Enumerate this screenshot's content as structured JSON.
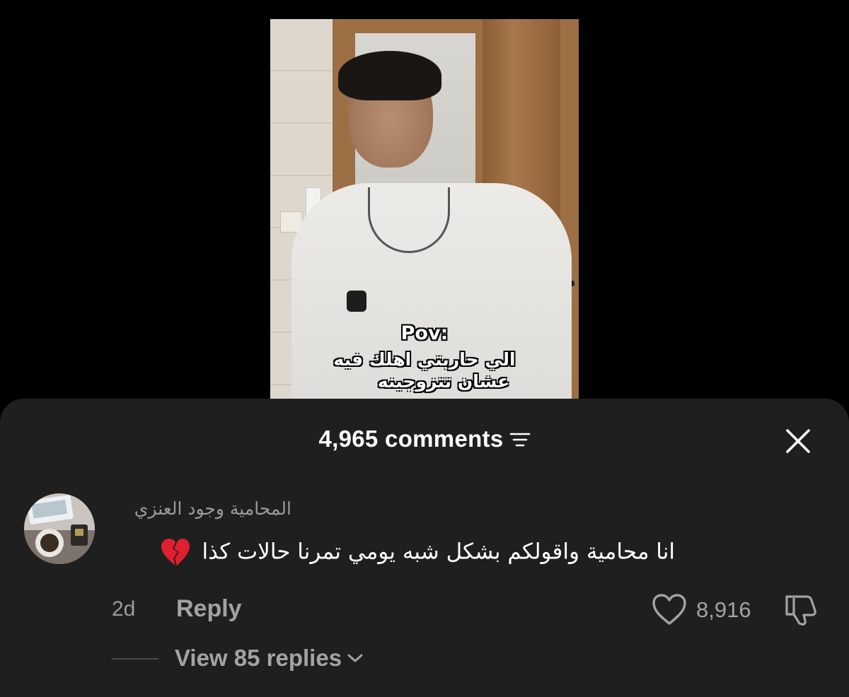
{
  "video": {
    "caption_line1": "Pov:",
    "caption_line2": "الي حاربتي اهلك فيه",
    "caption_line3": "عشان تتزوجينه"
  },
  "sheet": {
    "comments_count": "4,965 comments",
    "close_label": "×"
  },
  "comment": {
    "author": "المحامية وجود العنزي",
    "text": "انا محامية واقولكم بشكل شبه يومي تمرنا حالات كذا",
    "emoji": "broken-heart-emoji",
    "age": "2d",
    "reply_label": "Reply",
    "like_count": "8,916",
    "view_replies_label": "View 85 replies"
  },
  "icons": {
    "sort": "sort-icon",
    "close": "close-icon",
    "like": "heart-outline-icon",
    "dislike": "thumbs-down-icon",
    "expand": "chevron-down-icon"
  },
  "colors": {
    "sheet_background": "#1f1f1f",
    "primary_text": "#ffffff",
    "secondary_text": "#a3a3a3",
    "broken_heart": "#e0202f"
  }
}
